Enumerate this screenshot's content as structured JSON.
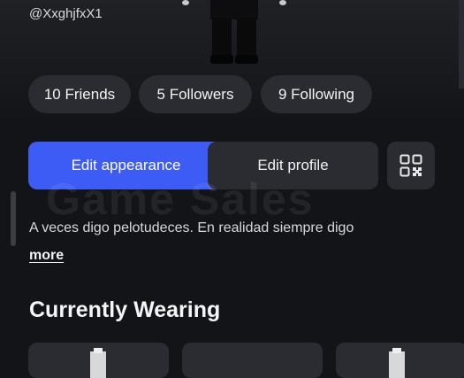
{
  "profile": {
    "username": "@XxghjfxX1",
    "bio": "A veces digo pelotudeces. En realidad siempre digo",
    "more_label": "more"
  },
  "stats": {
    "friends": "10 Friends",
    "followers": "5 Followers",
    "following": "9 Following"
  },
  "actions": {
    "edit_appearance": "Edit appearance",
    "edit_profile": "Edit profile",
    "qr_icon": "qr-code-icon"
  },
  "currently_wearing": {
    "title": "Currently Wearing",
    "items_visible": 3
  },
  "watermark": "Game Sales",
  "colors": {
    "background": "#131417",
    "surface": "#2a2c31",
    "accent": "#3d5cf5",
    "text": "#f2f2f3"
  }
}
